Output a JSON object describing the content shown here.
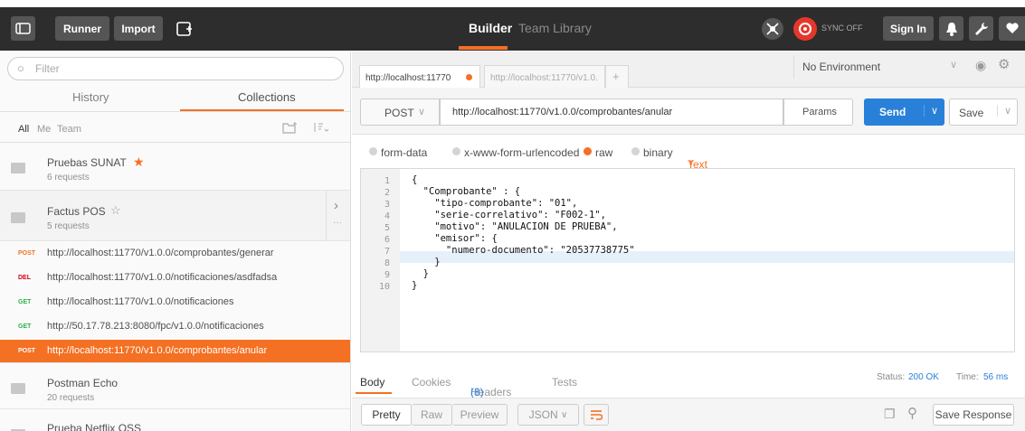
{
  "topbar": {
    "runner": "Runner",
    "import": "Import",
    "builder": "Builder",
    "team_library": "Team Library",
    "sync": "SYNC OFF",
    "sign_in": "Sign In"
  },
  "sidebar": {
    "filter_placeholder": "Filter",
    "tabs": [
      "History",
      "Collections"
    ],
    "scope_all": "All",
    "scope_me": "Me",
    "scope_team": "Team",
    "collections": [
      {
        "name": "Pruebas SUNAT",
        "sub": "6 requests"
      },
      {
        "name": "Factus POS",
        "sub": "5 requests"
      },
      {
        "name": "Postman Echo",
        "sub": "20 requests"
      },
      {
        "name": "Prueba Netflix OSS",
        "sub": ""
      }
    ],
    "requests": [
      {
        "method": "POST",
        "url": "http://localhost:11770/v1.0.0/comprobantes/generar"
      },
      {
        "method": "DEL",
        "url": "http://localhost:11770/v1.0.0/notificaciones/asdfadsa"
      },
      {
        "method": "GET",
        "url": "http://localhost:11770/v1.0.0/notificaciones"
      },
      {
        "method": "GET",
        "url": "http://50.17.78.213:8080/fpc/v1.0.0/notificaciones"
      },
      {
        "method": "POST",
        "url": "http://localhost:11770/v1.0.0/comprobantes/anular"
      }
    ]
  },
  "main": {
    "tab1": "http://localhost:11770",
    "tab2": "http://localhost:11770/v1.0.",
    "tab_add": "+",
    "environment": "No Environment",
    "method": "POST",
    "url": "http://localhost:11770/v1.0.0/comprobantes/anular",
    "params": "Params",
    "send": "Send",
    "save": "Save",
    "body_opts": [
      "form-data",
      "x-www-form-urlencoded",
      "raw",
      "binary"
    ],
    "text_type": "Text",
    "code_lines": [
      "{",
      "  \"Comprobante\" : {",
      "    \"tipo-comprobante\": \"01\",",
      "    \"serie-correlativo\": \"F002-1\",",
      "    \"motivo\": \"ANULACION DE PRUEBA\",",
      "    \"emisor\": {",
      "      \"numero-documento\": \"20537738775\"",
      "    }",
      "  }",
      "}"
    ],
    "line_numbers": [
      "1",
      "2",
      "3",
      "4",
      "5",
      "6",
      "7",
      "8",
      "9",
      "10"
    ],
    "resp_tabs": {
      "body": "Body",
      "cookies": "Cookies",
      "headers": "Headers",
      "headers_count": "(8)",
      "tests": "Tests"
    },
    "status_label": "Status:",
    "status_value": "200 OK",
    "time_label": "Time:",
    "time_value": "56 ms",
    "pretty": "Pretty",
    "raw_view": "Raw",
    "preview": "Preview",
    "format": "JSON",
    "save_response": "Save Response"
  },
  "colors": {
    "accent": "#f47023",
    "send": "#2980d9",
    "post": "#f47023",
    "del": "#d0021b",
    "get": "#2db34a"
  }
}
